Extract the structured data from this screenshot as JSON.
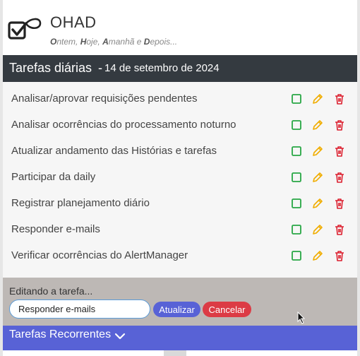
{
  "app": {
    "title": "OHAD",
    "tagline_parts": [
      {
        "bold": "O",
        "rest": "ntem, "
      },
      {
        "bold": "H",
        "rest": "oje, "
      },
      {
        "bold": "A",
        "rest": "manhã e "
      },
      {
        "bold": "D",
        "rest": "epois..."
      }
    ]
  },
  "daily": {
    "title": "Tarefas diárias",
    "separator": "-",
    "date": "14 de setembro de 2024"
  },
  "tasks": [
    {
      "label": "Analisar/aprovar requisições pendentes"
    },
    {
      "label": "Analisar ocorrências do processamento noturno"
    },
    {
      "label": "Atualizar andamento das Histórias e tarefas"
    },
    {
      "label": "Participar da daily"
    },
    {
      "label": "Registrar planejamento diário"
    },
    {
      "label": "Responder e-mails"
    },
    {
      "label": "Verificar ocorrências do AlertManager"
    }
  ],
  "task_action_icons": [
    "square-check-icon",
    "pencil-icon",
    "trash-icon"
  ],
  "edit": {
    "caption": "Editando a tarefa...",
    "value": "Responder e-mails",
    "update_label": "Atualizar",
    "cancel_label": "Cancelar"
  },
  "recurring": {
    "label": "Tarefas Recorrentes",
    "icon": "chevron-down-icon"
  },
  "colors": {
    "check": "#28a745",
    "edit": "#f0ad00",
    "delete": "#dc1f2e",
    "dark_bar": "#343a40",
    "accent": "#5862d6",
    "cancel": "#dc3b45",
    "edit_panel": "#bdb8b5"
  }
}
